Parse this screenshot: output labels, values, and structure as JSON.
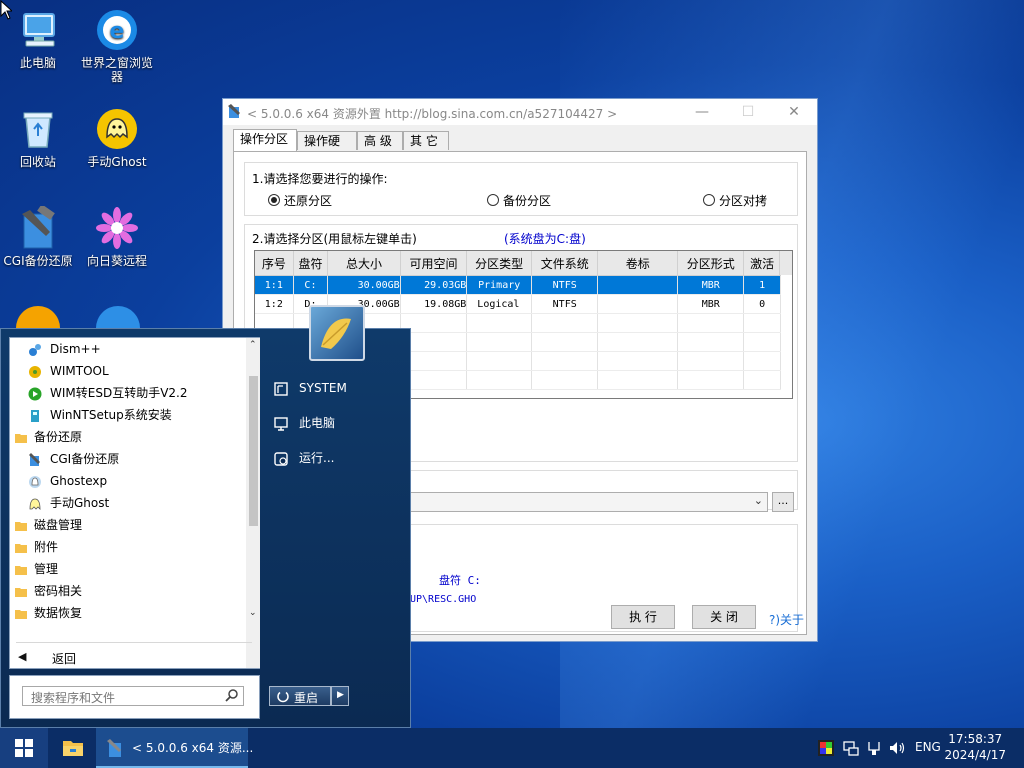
{
  "desktop": {
    "icons": [
      {
        "label": "此电脑"
      },
      {
        "label": "世界之窗浏览器"
      },
      {
        "label": "回收站"
      },
      {
        "label": "手动Ghost"
      },
      {
        "label": "CGI备份还原"
      },
      {
        "label": "向日葵远程"
      }
    ]
  },
  "window": {
    "title": "< 5.0.0.6 x64 资源外置 http://blog.sina.com.cn/a527104427 >",
    "controls": {
      "minimize": "—",
      "maximize": "☐",
      "close": "✕"
    },
    "tabs": [
      "操作分区",
      "操作硬盘",
      "高 级",
      "其 它"
    ],
    "step1_label": "1.请选择您要进行的操作:",
    "options": [
      "还原分区",
      "备份分区",
      "分区对拷"
    ],
    "selected_option": "还原分区",
    "step2_label": "2.请选择分区(用鼠标左键单击)",
    "system_disk_note": "(系统盘为C:盘)",
    "table": {
      "headers": [
        "序号",
        "盘符",
        "总大小",
        "可用空间",
        "分区类型",
        "文件系统",
        "卷标",
        "分区形式",
        "激活"
      ],
      "rows": [
        [
          "1:1",
          "C:",
          "30.00GB",
          "29.03GB",
          "Primary",
          "NTFS",
          "",
          "MBR",
          "1"
        ],
        [
          "1:2",
          "D:",
          "30.00GB",
          "19.08GB",
          "Logical",
          "NTFS",
          "",
          "MBR",
          "0"
        ]
      ]
    },
    "browse_label": "...",
    "info_drive": "盘符 C:",
    "info_path": "UP\\RESC.GHO",
    "buttons": {
      "execute": "执 行",
      "close": "关 闭",
      "about": "?)关于"
    }
  },
  "start_menu": {
    "programs": [
      {
        "label": "Dism++",
        "type": "app"
      },
      {
        "label": "WIMTOOL",
        "type": "app"
      },
      {
        "label": "WIM转ESD互转助手V2.2",
        "type": "app"
      },
      {
        "label": "WinNTSetup系统安装",
        "type": "app"
      },
      {
        "label": "备份还原",
        "type": "folder"
      },
      {
        "label": "CGI备份还原",
        "type": "app"
      },
      {
        "label": "Ghostexp",
        "type": "app"
      },
      {
        "label": "手动Ghost",
        "type": "app"
      },
      {
        "label": "磁盘管理",
        "type": "folder"
      },
      {
        "label": "附件",
        "type": "folder"
      },
      {
        "label": "管理",
        "type": "folder"
      },
      {
        "label": "密码相关",
        "type": "folder"
      },
      {
        "label": "数据恢复",
        "type": "folder"
      }
    ],
    "back_label": "返回",
    "search_placeholder": "搜索程序和文件",
    "right_items": [
      "SYSTEM",
      "此电脑",
      "运行..."
    ],
    "restart_label": "重启"
  },
  "taskbar": {
    "active_window_label": "< 5.0.0.6 x64 资源...",
    "language": "ENG",
    "time": "17:58:37",
    "date": "2024/4/17"
  },
  "colors": {
    "selection": "#0078d7",
    "note_blue": "#0000cc",
    "taskbar": "#0b2d66"
  }
}
